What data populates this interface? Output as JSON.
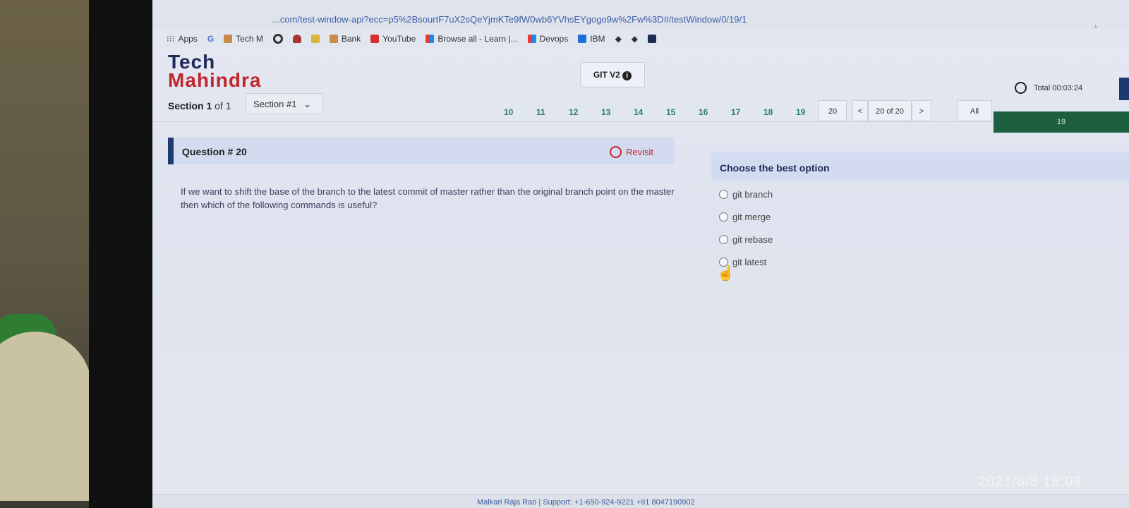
{
  "browser": {
    "url": "...com/test-window-api?ecc=p5%2BsourtF7uX2sQeYjmKTe9fW0wb6YVhsEYgogo9w%2Fw%3D#/testWindow/0/19/1",
    "bookmarks": [
      "Apps",
      "Tech M",
      "Bank",
      "YouTube",
      "Browse all - Learn |...",
      "Devops",
      "IBM"
    ]
  },
  "header": {
    "logo_line1": "Tech",
    "logo_line2": "Mahindra",
    "test_name": "GIT V2",
    "timer": "Total 00:03:24"
  },
  "nav": {
    "section_label_bold": "Section 1",
    "section_label_rest": "of 1",
    "section_select": "Section #1",
    "question_numbers": [
      "10",
      "11",
      "12",
      "13",
      "14",
      "15",
      "16",
      "17",
      "18",
      "19"
    ],
    "current": "20",
    "prev": "<",
    "page_info": "20 of 20",
    "next": ">",
    "filter": "All",
    "progress_count": "19"
  },
  "question": {
    "title": "Question # 20",
    "revisit": "Revisit",
    "text": "If we want to shift the base of the branch to the latest commit of master rather than the original branch point on the master then which of the following commands is useful?"
  },
  "answers": {
    "title": "Choose the best option",
    "options": [
      "git branch",
      "git merge",
      "git rebase",
      "git latest"
    ]
  },
  "footer": {
    "text": "Malkari Raja Rao | Support: +1-650-924-9221  +91 8047190902"
  },
  "photo_timestamp": "2021/8/8 18:09",
  "colors": {
    "brand_navy": "#1e2b57",
    "brand_red": "#c1272d",
    "accent_green": "#1e5f3f"
  }
}
